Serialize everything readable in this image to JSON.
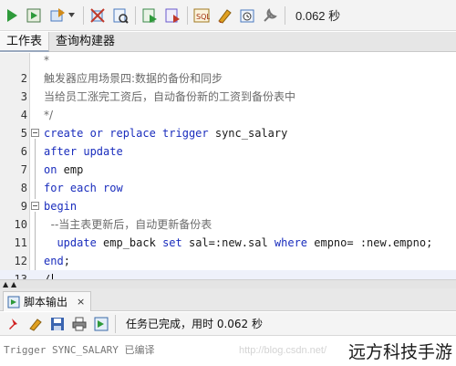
{
  "toolbar": {
    "items": [
      {
        "name": "run-statement-icon",
        "color": "#2e9a3a"
      },
      {
        "name": "run-script-icon",
        "color": "#3c8a3c"
      },
      {
        "name": "commit-icon",
        "color": "#4a7abf"
      },
      {
        "name": "rollback-icon",
        "color": "#c0392b"
      },
      {
        "name": "explain-plan-icon",
        "color": "#4a7abf"
      },
      {
        "name": "autotrace-icon",
        "color": "#3a8a4a"
      },
      {
        "name": "sql-tuning-icon",
        "color": "#6a5acd"
      },
      {
        "name": "clear-icon",
        "color": "#e0a020"
      },
      {
        "name": "history-icon",
        "color": "#4a7abf"
      },
      {
        "name": "tools-icon",
        "color": "#777777"
      }
    ],
    "elapsed": "0.062 秒"
  },
  "editor_tabs": [
    {
      "label": "工作表",
      "active": true
    },
    {
      "label": "查询构建器",
      "active": false
    }
  ],
  "editor": {
    "lines": [
      {
        "num": "",
        "text": "*",
        "type": "comment"
      },
      {
        "num": "2",
        "text": "触发器应用场景四:数据的备份和同步",
        "type": "comment"
      },
      {
        "num": "3",
        "text": "当给员工涨完工资后，自动备份新的工资到备份表中",
        "type": "comment"
      },
      {
        "num": "4",
        "text": "*/",
        "type": "comment"
      },
      {
        "num": "5",
        "fold": true,
        "kw": "create or replace trigger",
        "rest": " sync_salary"
      },
      {
        "num": "6",
        "kw": "after update",
        "rest": ""
      },
      {
        "num": "7",
        "kw": "on",
        "rest": " emp"
      },
      {
        "num": "8",
        "kw": "for each row",
        "rest": ""
      },
      {
        "num": "9",
        "fold": true,
        "kw": "begin",
        "rest": ""
      },
      {
        "num": "10",
        "text": "  --当主表更新后，自动更新备份表",
        "type": "comment"
      },
      {
        "num": "11",
        "indent": "  ",
        "kw": "update",
        "rest": " emp_back ",
        "kw2": "set",
        "rest2": " sal=:new.sal ",
        "kw3": "where",
        "rest3": " empno= :new.empno;"
      },
      {
        "num": "12",
        "kw": "end",
        "rest": ";"
      },
      {
        "num": "13",
        "text": "/",
        "type": "plain",
        "current": true
      }
    ]
  },
  "output_panel": {
    "tab_label": "脚本输出",
    "close": "×",
    "status": "任务已完成，用时 0.062 秒",
    "output_line": "Trigger SYNC_SALARY 已编译",
    "watermark": "http://blog.csdn.net/",
    "brand": "远方科技手游"
  }
}
